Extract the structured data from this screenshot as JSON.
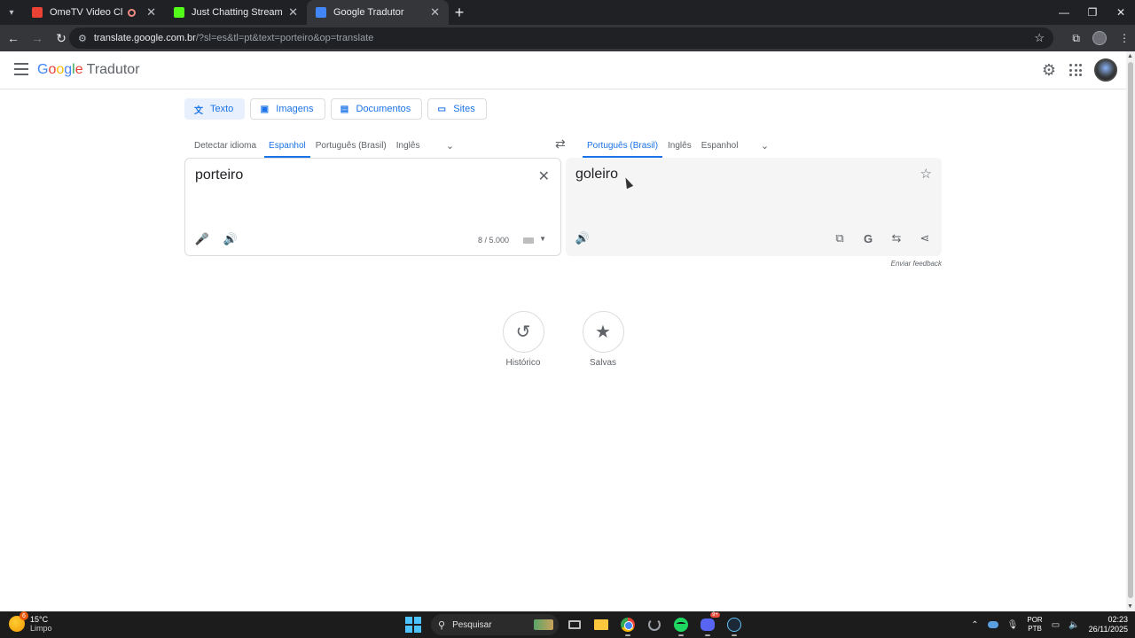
{
  "browser": {
    "tabs": [
      {
        "title": "OmeTV Video Chat — Ome",
        "favicon_color": "#ea4335"
      },
      {
        "title": "Just Chatting Streaming - Live",
        "favicon_color": "#53fc18"
      },
      {
        "title": "Google Tradutor",
        "favicon_color": "#4285f4"
      }
    ],
    "url_host": "translate.google.com.br",
    "url_path": "/?sl=es&tl=pt&text=porteiro&op=translate"
  },
  "header": {
    "logo_letters": [
      "G",
      "o",
      "o",
      "g",
      "l",
      "e"
    ],
    "product": "Tradutor"
  },
  "modes": [
    {
      "label": "Texto",
      "icon": "translate-icon"
    },
    {
      "label": "Imagens",
      "icon": "image-icon"
    },
    {
      "label": "Documentos",
      "icon": "document-icon"
    },
    {
      "label": "Sites",
      "icon": "web-icon"
    }
  ],
  "source_langs": [
    "Detectar idioma",
    "Espanhol",
    "Português (Brasil)",
    "Inglês"
  ],
  "target_langs": [
    "Português (Brasil)",
    "Inglês",
    "Espanhol"
  ],
  "source": {
    "text": "porteiro",
    "counter": "8 / 5.000"
  },
  "target": {
    "text": "goleiro"
  },
  "feedback": "Enviar feedback",
  "shortcuts": [
    {
      "label": "Histórico",
      "icon": "history-icon"
    },
    {
      "label": "Salvas",
      "icon": "star-icon"
    }
  ],
  "taskbar": {
    "temperature": "15°C",
    "condition": "Limpo",
    "weather_badge": "6",
    "search_placeholder": "Pesquisar",
    "discord_badge": "9+",
    "kbd_lang": "POR",
    "kbd_layout": "PTB",
    "time": "02:23",
    "date": "26/11/2025"
  },
  "colors": {
    "accent": "#1a73e8",
    "chrome_dark": "#202124"
  }
}
